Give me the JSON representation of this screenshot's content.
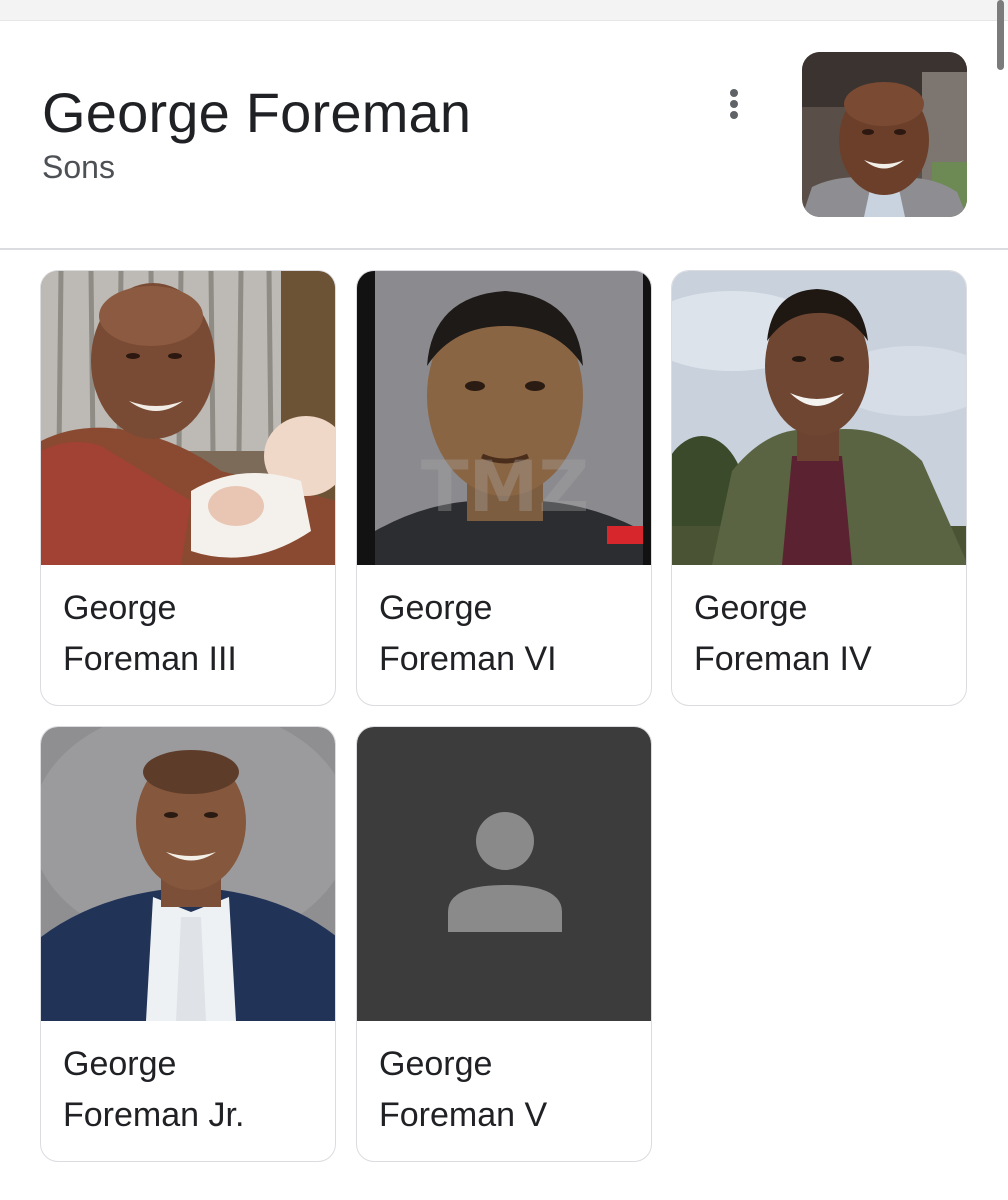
{
  "header": {
    "title": "George Foreman",
    "subtitle": "Sons",
    "more_icon": "more-vert-icon"
  },
  "cards": [
    {
      "name_line1": "George",
      "name_line2": "Foreman III"
    },
    {
      "name_line1": "George",
      "name_line2": "Foreman VI"
    },
    {
      "name_line1": "George",
      "name_line2": "Foreman IV"
    },
    {
      "name_line1": "George",
      "name_line2": "Foreman Jr."
    },
    {
      "name_line1": "George",
      "name_line2": "Foreman V"
    }
  ],
  "photo_watermark": "TMZ",
  "colors": {
    "title_text": "#202124",
    "subtitle_text": "#4d5156",
    "card_border": "#dadce0",
    "placeholder_bg": "#3c3c3c",
    "placeholder_icon": "#8a8a8a"
  }
}
